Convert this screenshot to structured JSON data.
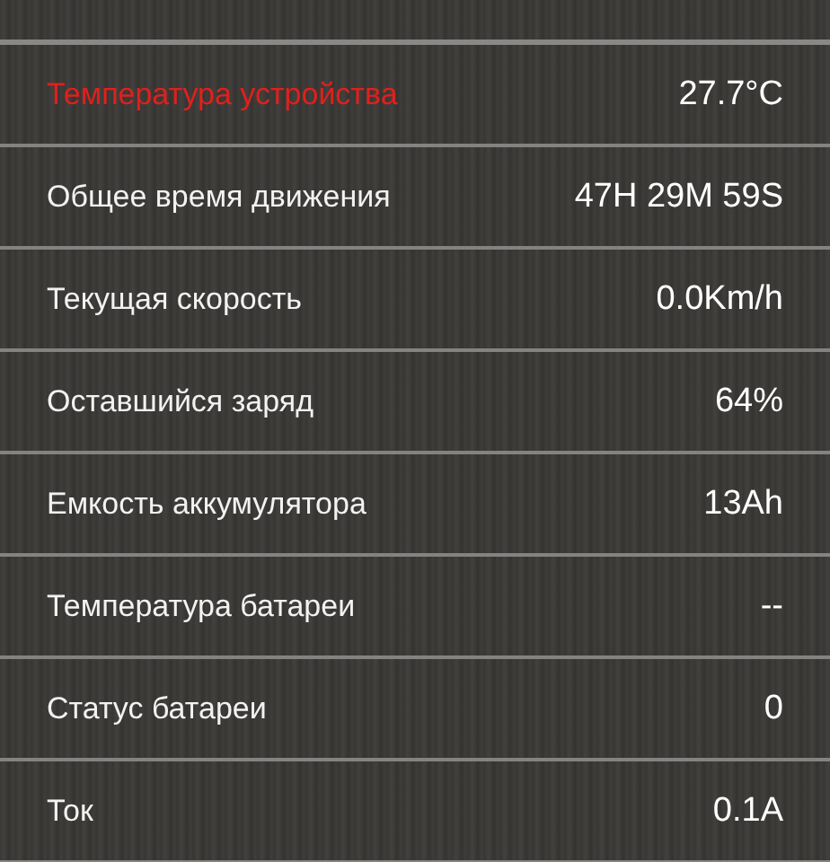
{
  "rows": [
    {
      "label": "Температура устройства",
      "value": "27.7°C",
      "highlighted": true
    },
    {
      "label": "Общее время движения",
      "value": "47H 29M 59S",
      "highlighted": false
    },
    {
      "label": "Текущая скорость",
      "value": "0.0Km/h",
      "highlighted": false
    },
    {
      "label": "Оставшийся заряд",
      "value": "64%",
      "highlighted": false
    },
    {
      "label": "Емкость аккумулятора",
      "value": "13Ah",
      "highlighted": false
    },
    {
      "label": "Температура батареи",
      "value": "--",
      "highlighted": false
    },
    {
      "label": "Статус батареи",
      "value": "0",
      "highlighted": false
    },
    {
      "label": "Ток",
      "value": "0.1A",
      "highlighted": false
    }
  ]
}
